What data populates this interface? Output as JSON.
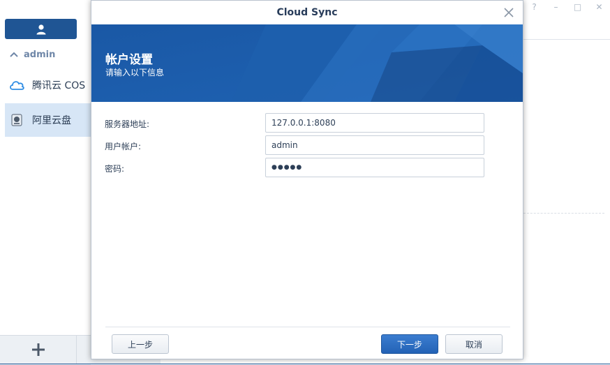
{
  "app": {
    "window_controls": [
      "?",
      "–",
      "□",
      "✕"
    ],
    "sidebar": {
      "user_group": "admin",
      "items": [
        {
          "label": "腾讯云 COS",
          "icon": "cloud-icon"
        },
        {
          "label": "阿里云盘",
          "icon": "drive-icon"
        }
      ],
      "add_label": "+"
    }
  },
  "dialog": {
    "title": "Cloud Sync",
    "header": {
      "title": "帐户设置",
      "subtitle": "请输入以下信息"
    },
    "fields": [
      {
        "label": "服务器地址:",
        "value": "127.0.0.1:8080"
      },
      {
        "label": "用户帐户:",
        "value": "admin"
      },
      {
        "label": "密码:",
        "value": "●●●●●"
      }
    ],
    "buttons": {
      "back": "上一步",
      "next": "下一步",
      "cancel": "取消"
    }
  },
  "colors": {
    "accent": "#1f5594",
    "banner": "#1d5ca8",
    "selected_item": "#d7e6f6",
    "primary_button": "#2a6bbf"
  }
}
